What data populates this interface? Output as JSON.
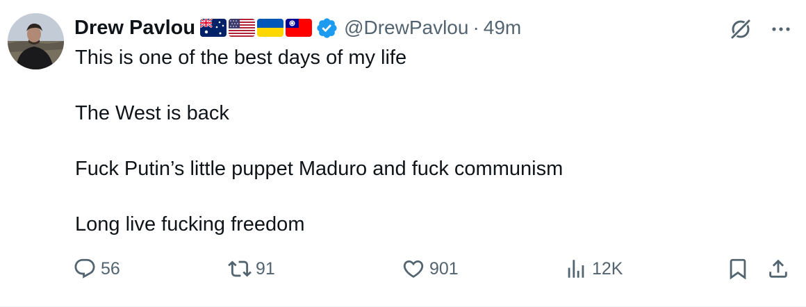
{
  "author": {
    "display_name": "Drew Pavlou",
    "handle": "@DrewPavlou",
    "separator": "·",
    "timestamp": "49m",
    "flags": [
      "australia-flag",
      "usa-flag",
      "ukraine-flag",
      "taiwan-flag"
    ],
    "verified_badge": "verified-badge-icon"
  },
  "tweet": {
    "lines": [
      "This is one of the best days of my life",
      "The West is back",
      "Fuck Putin’s little puppet Maduro and fuck communism",
      "Long live fucking freedom"
    ]
  },
  "actions": {
    "reply_count": "56",
    "retweet_count": "91",
    "like_count": "901",
    "view_count": "12K"
  },
  "colors": {
    "text": "#0f1419",
    "secondary": "#536471",
    "verified": "#1d9bf0",
    "border": "#eff3f4"
  },
  "icons": {
    "top_right": [
      "grok-icon",
      "more-options-icon"
    ],
    "action_bar": [
      "reply-icon",
      "retweet-icon",
      "like-icon",
      "views-icon",
      "bookmark-icon",
      "share-icon"
    ]
  }
}
